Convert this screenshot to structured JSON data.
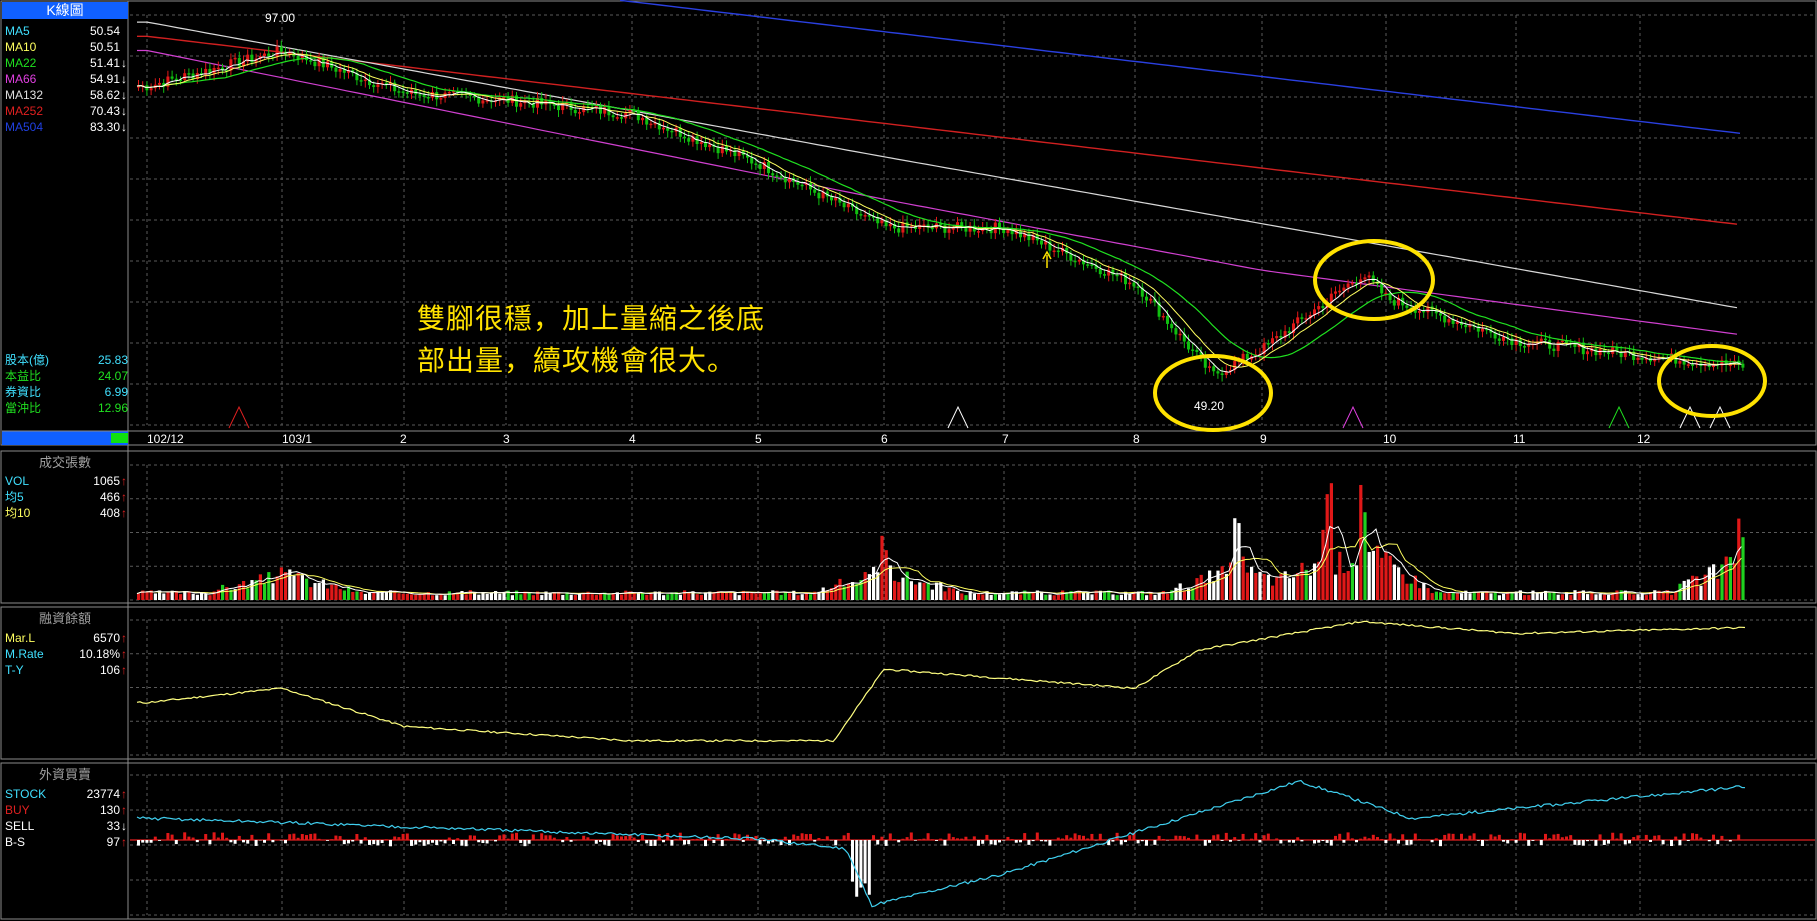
{
  "panels": {
    "kline": {
      "title": "K線圖",
      "indicators": [
        {
          "name": "MA5",
          "value": "50.54",
          "color": "#40e0ff"
        },
        {
          "name": "MA10",
          "value": "50.51",
          "color": "#ffff60"
        },
        {
          "name": "MA22",
          "value": "51.41",
          "arrow": "↓",
          "color": "#20e020"
        },
        {
          "name": "MA66",
          "value": "54.91",
          "arrow": "↓",
          "color": "#e040e0"
        },
        {
          "name": "MA132",
          "value": "58.62",
          "arrow": "↓",
          "color": "#e0e0e0"
        },
        {
          "name": "MA252",
          "value": "70.43",
          "arrow": "↓",
          "color": "#e02020"
        },
        {
          "name": "MA504",
          "value": "83.30",
          "arrow": "↓",
          "color": "#2040e0"
        }
      ],
      "stats": [
        {
          "name": "股本(億)",
          "value": "25.83"
        },
        {
          "name": "本益比",
          "value": "24.07"
        },
        {
          "name": "券資比",
          "value": "6.99"
        },
        {
          "name": "當沖比",
          "value": "12.96"
        }
      ],
      "high_label": "97.00",
      "low_label": "49.20",
      "annotation": [
        "雙腳很穩，加上量縮之後底",
        "部出量，續攻機會很大。"
      ]
    },
    "volume": {
      "title": "成交張數",
      "indicators": [
        {
          "name": "VOL",
          "value": "1065",
          "arrow": "↑",
          "color": "#40e0ff"
        },
        {
          "name": "均5",
          "value": "466",
          "arrow": "↑",
          "color": "#40e0ff"
        },
        {
          "name": "均10",
          "value": "408",
          "arrow": "↑",
          "color": "#ffff60"
        }
      ]
    },
    "margin": {
      "title": "融資餘額",
      "indicators": [
        {
          "name": "Mar.L",
          "value": "6570",
          "arrow": "↑",
          "color": "#ffff60"
        },
        {
          "name": "M.Rate",
          "value": "10.18%",
          "arrow": "↑",
          "color": "#40e0ff"
        },
        {
          "name": "T-Y",
          "value": "106",
          "arrow": "↑",
          "color": "#40e0ff"
        }
      ]
    },
    "foreign": {
      "title": "外資買賣",
      "indicators": [
        {
          "name": "STOCK",
          "value": "23774",
          "arrow": "↑",
          "color": "#40e0ff"
        },
        {
          "name": "BUY",
          "value": "130",
          "arrow": "↑",
          "color": "#e02020"
        },
        {
          "name": "SELL",
          "value": "33",
          "arrow": "↓",
          "color": "#ffffff"
        },
        {
          "name": "B-S",
          "value": "97",
          "arrow": "↑",
          "color": "#ffffff"
        }
      ]
    }
  },
  "chart_data": {
    "type": "line",
    "x_axis_labels": [
      "102/12",
      "103/1",
      "2",
      "3",
      "4",
      "5",
      "6",
      "7",
      "8",
      "9",
      "10",
      "11",
      "12"
    ],
    "price": {
      "ylim": [
        45,
        100
      ],
      "close_series": [
        {
          "month": "102/12",
          "value": 90
        },
        {
          "month": "103/1",
          "value": 95
        },
        {
          "month": "2",
          "value": 89
        },
        {
          "month": "3",
          "value": 88
        },
        {
          "month": "4",
          "value": 86
        },
        {
          "month": "5",
          "value": 79
        },
        {
          "month": "6",
          "value": 70
        },
        {
          "month": "7",
          "value": 70
        },
        {
          "month": "8",
          "value": 62
        },
        {
          "month": "8.6",
          "value": 49.2
        },
        {
          "month": "9",
          "value": 53
        },
        {
          "month": "9.8",
          "value": 63.5
        },
        {
          "month": "10",
          "value": 60
        },
        {
          "month": "11",
          "value": 54
        },
        {
          "month": "12",
          "value": 52
        },
        {
          "month": "12.8",
          "value": 50.5
        }
      ],
      "ma504": [
        {
          "month": "102/12",
          "value": 110
        },
        {
          "month": "12.8",
          "value": 83.3
        }
      ],
      "ma252": [
        {
          "month": "102/12",
          "value": 97
        },
        {
          "month": "12.8",
          "value": 70.43
        }
      ],
      "ma132": [
        {
          "month": "102/12",
          "value": 99
        },
        {
          "month": "6",
          "value": 80
        },
        {
          "month": "12.8",
          "value": 58.62
        }
      ],
      "ma66": [
        {
          "month": "102/12",
          "value": 95
        },
        {
          "month": "6",
          "value": 74
        },
        {
          "month": "9",
          "value": 64
        },
        {
          "month": "12.8",
          "value": 54.91
        }
      ]
    },
    "volume_peaks": [
      {
        "month": "103/1",
        "value": 520
      },
      {
        "month": "6",
        "value": 640
      },
      {
        "month": "8.8",
        "value": 770
      },
      {
        "month": "9.5",
        "value": 1100
      },
      {
        "month": "9.8",
        "value": 1470
      },
      {
        "month": "12.8",
        "value": 1065
      }
    ],
    "margin_balance": [
      {
        "month": "102/12",
        "value": 5000
      },
      {
        "month": "103/1",
        "value": 5300
      },
      {
        "month": "2",
        "value": 4500
      },
      {
        "month": "4",
        "value": 4200
      },
      {
        "month": "5.6",
        "value": 4200
      },
      {
        "month": "6",
        "value": 5700
      },
      {
        "month": "8",
        "value": 5300
      },
      {
        "month": "8.5",
        "value": 6100
      },
      {
        "month": "9.8",
        "value": 6700
      },
      {
        "month": "11",
        "value": 6450
      },
      {
        "month": "12.8",
        "value": 6570
      }
    ],
    "foreign_stock": [
      {
        "month": "102/12",
        "value": 21500
      },
      {
        "month": "103/1",
        "value": 21200
      },
      {
        "month": "5",
        "value": 20000
      },
      {
        "month": "5.7",
        "value": 19300
      },
      {
        "month": "5.9",
        "value": 15200
      },
      {
        "month": "7",
        "value": 17500
      },
      {
        "month": "9.3",
        "value": 24200
      },
      {
        "month": "10.2",
        "value": 21500
      },
      {
        "month": "12.8",
        "value": 23774
      }
    ]
  }
}
